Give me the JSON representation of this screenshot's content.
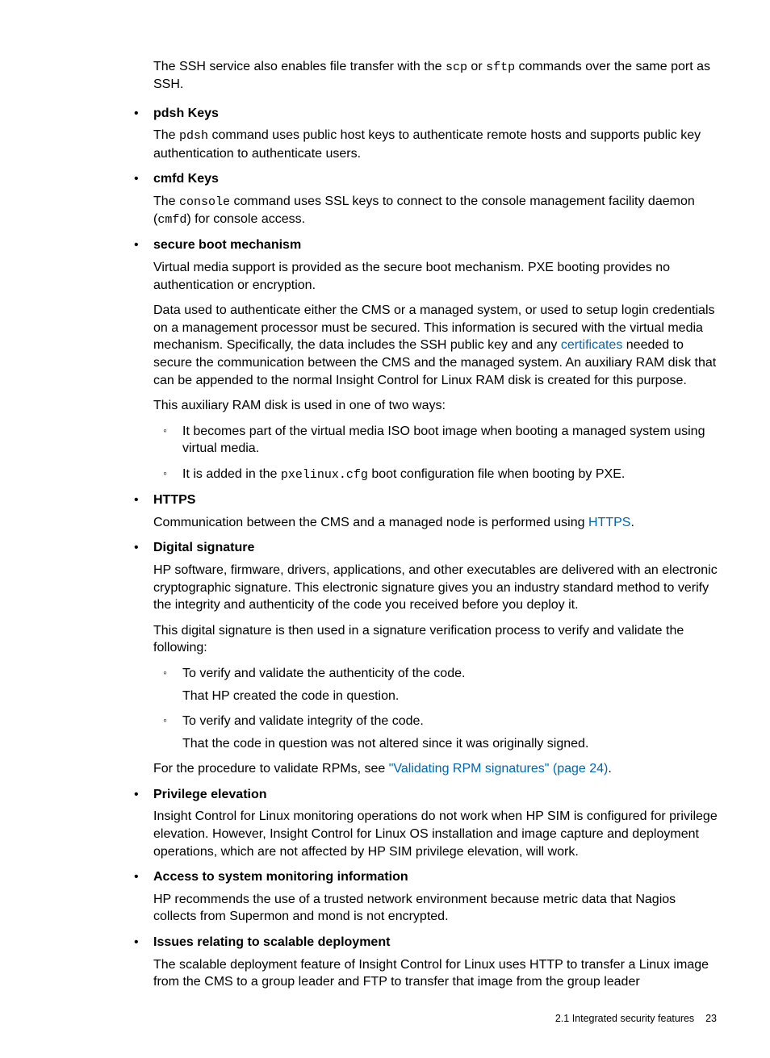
{
  "intro_pre": "The SSH service also enables file transfer with the ",
  "intro_code1": "scp",
  "intro_mid": " or ",
  "intro_code2": "sftp",
  "intro_post": " commands over the same port as SSH.",
  "s1": {
    "h": "pdsh Keys",
    "t1a": "The ",
    "t1b": "pdsh",
    "t1c": " command uses public host keys to authenticate remote hosts and supports public key authentication to authenticate users."
  },
  "s2": {
    "h": "cmfd Keys",
    "t1a": "The ",
    "t1b": "console",
    "t1c": " command uses SSL keys to connect to the console management facility daemon (",
    "t1d": "cmfd",
    "t1e": ") for console access."
  },
  "s3": {
    "h": "secure boot mechanism",
    "p1": "Virtual media support is provided as the secure boot mechanism. PXE booting provides no authentication or encryption.",
    "p2a": "Data used to authenticate either the CMS or a managed system, or used to setup login credentials on a management processor must be secured. This information is secured with the virtual media mechanism. Specifically, the data includes the SSH public key and any ",
    "p2link": "certificates",
    "p2b": " needed to secure the communication between the CMS and the managed system. An auxiliary RAM disk that can be appended to the normal Insight Control for Linux RAM disk is created for this purpose.",
    "p3": "This auxiliary RAM disk is used in one of two ways:",
    "sub1": "It becomes part of the virtual media ISO boot image when booting a managed system using virtual media.",
    "sub2a": "It is added in the ",
    "sub2b": "pxelinux.cfg",
    "sub2c": " boot configuration file when booting by PXE."
  },
  "s4": {
    "h": "HTTPS",
    "p1a": "Communication between the CMS and a managed node is performed using ",
    "p1link": "HTTPS",
    "p1b": "."
  },
  "s5": {
    "h": "Digital signature",
    "p1": "HP software, firmware, drivers, applications, and other executables are delivered with an electronic cryptographic signature. This electronic signature gives you an industry standard method to verify the integrity and authenticity of the code you received before you deploy it.",
    "p2": "This digital signature is then used in a signature verification process to verify and validate the following:",
    "sub1a": "To verify and validate the authenticity of the code.",
    "sub1b": "That HP created the code in question.",
    "sub2a": "To verify and validate integrity of the code.",
    "sub2b": "That the code in question was not altered since it was originally signed.",
    "p3a": "For the procedure to validate RPMs, see ",
    "p3link": "\"Validating RPM signatures\" (page 24)",
    "p3b": "."
  },
  "s6": {
    "h": "Privilege elevation",
    "p1": "Insight Control for Linux monitoring operations do not work when HP SIM is configured for privilege elevation. However, Insight Control for Linux OS installation and image capture and deployment operations, which are not affected by HP SIM privilege elevation, will work."
  },
  "s7": {
    "h": "Access to system monitoring information",
    "p1": "HP recommends the use of a trusted network environment because metric data that Nagios collects from Supermon and mond is not encrypted."
  },
  "s8": {
    "h": "Issues relating to scalable deployment",
    "p1": "The scalable deployment feature of Insight Control for Linux uses HTTP to transfer a Linux image from the CMS to a group leader and FTP to transfer that image from the group leader"
  },
  "footer": {
    "section": "2.1 Integrated security features",
    "page": "23"
  }
}
